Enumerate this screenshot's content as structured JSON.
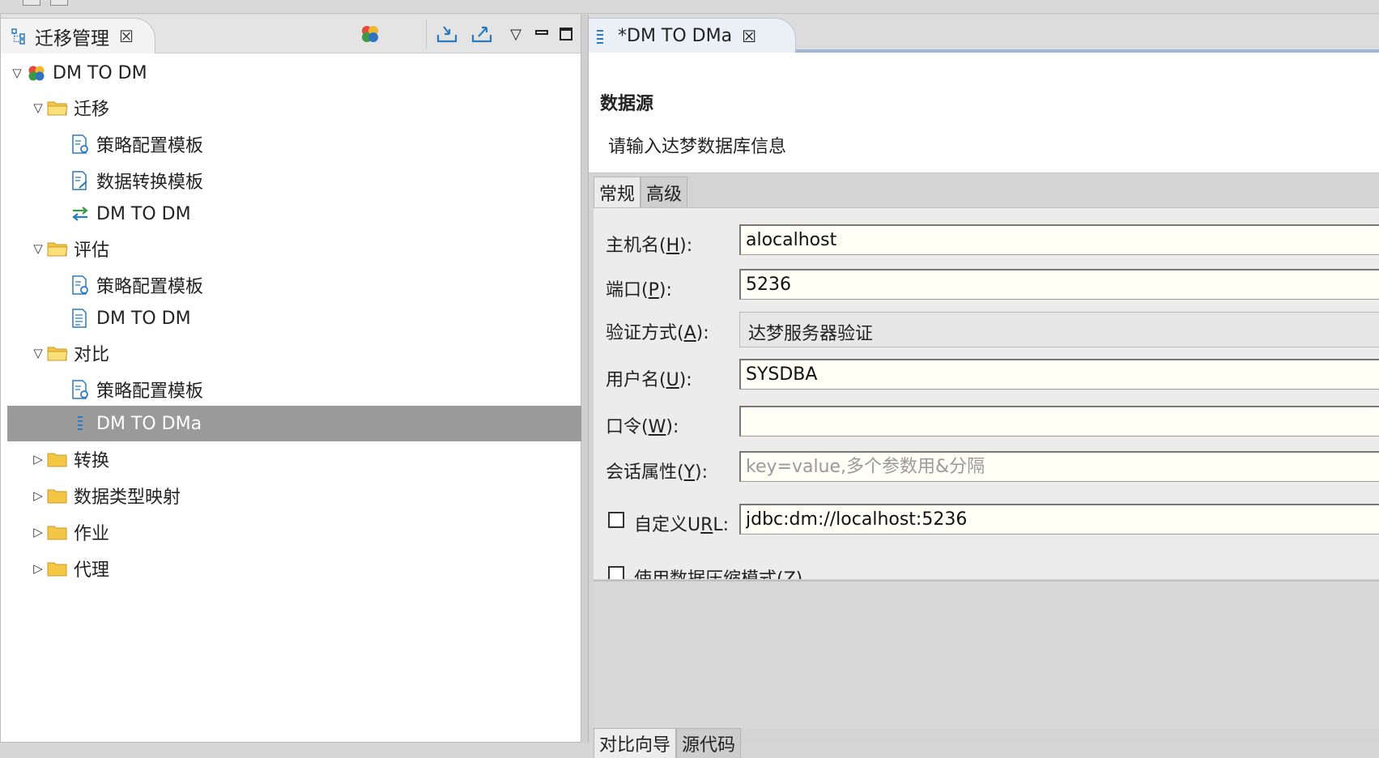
{
  "left_view": {
    "tab_title": "迁移管理",
    "tab_close": "☒",
    "toolbar": {
      "import_icon": "import-icon",
      "export_icon": "export-icon",
      "view_menu": "▽",
      "minimize": "▭",
      "maximize": "□"
    }
  },
  "tree": {
    "root": "DM TO DM",
    "migrate_folder": "迁移",
    "migrate_strategy": "策略配置模板",
    "migrate_transform": "数据转换模板",
    "migrate_job": "DM TO DM",
    "assess_folder": "评估",
    "assess_strategy": "策略配置模板",
    "assess_job": "DM TO DM",
    "compare_folder": "对比",
    "compare_strategy": "策略配置模板",
    "compare_job": "DM TO DMa",
    "convert_folder": "转换",
    "type_mapping_folder": "数据类型映射",
    "jobs_folder": "作业",
    "agent_folder": "代理"
  },
  "editor": {
    "tab_title": "*DM TO DMa",
    "tab_close": "☒",
    "section_title": "数据源",
    "section_desc": "请输入达梦数据库信息",
    "inner_tabs": [
      "常规",
      "高级"
    ],
    "bottom_tabs": [
      "对比向导",
      "源代码"
    ]
  },
  "form": {
    "host": {
      "label_pre": "主机名(",
      "label_key": "H",
      "label_post": "):",
      "value": "alocalhost"
    },
    "port": {
      "label_pre": "端口(",
      "label_key": "P",
      "label_post": "):",
      "value": "5236"
    },
    "auth": {
      "label_pre": "验证方式(",
      "label_key": "A",
      "label_post": "):",
      "value": "达梦服务器验证"
    },
    "user": {
      "label_pre": "用户名(",
      "label_key": "U",
      "label_post": "):",
      "value": "SYSDBA"
    },
    "password": {
      "label_pre": "口令(",
      "label_key": "W",
      "label_post": "):",
      "value": ""
    },
    "session": {
      "label_pre": "会话属性(",
      "label_key": "Y",
      "label_post": "):",
      "placeholder": "key=value,多个参数用&分隔"
    },
    "custom_url": {
      "label_pre": "自定义U",
      "label_key": "R",
      "label_post": "L:",
      "value": "jdbc:dm://localhost:5236"
    },
    "compress": {
      "label": "使用数据压缩模式(Z)"
    }
  },
  "colors": {
    "selection": "#9a9a9a",
    "folder": "#f3c744",
    "accent_blue": "#2a7ac0"
  }
}
